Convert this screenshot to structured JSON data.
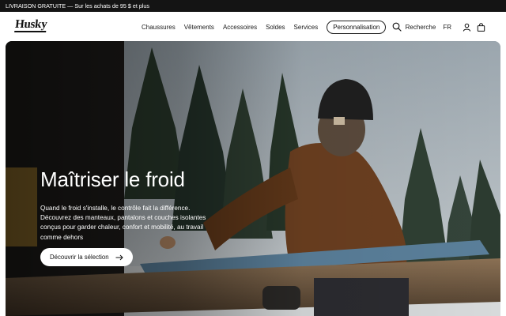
{
  "announcement": {
    "text": "LIVRAISON GRATUITE — Sur les achats de 95 $ et plus"
  },
  "header": {
    "logo": "Husky",
    "nav": [
      "Chaussures",
      "Vêtements",
      "Accessoires",
      "Soldes",
      "Services"
    ],
    "nav_pill": "Personnalisation",
    "search_label": "Recherche",
    "language": "FR",
    "icons": [
      "search-icon",
      "account-icon",
      "cart-icon"
    ]
  },
  "hero": {
    "title": "Maîtriser le froid",
    "body": "Quand le froid s'installe, le contrôle fait la différence. Découvrez des manteaux, pantalons et couches isolantes conçus pour garder chaleur, confort et mobilité, au travail comme dehors",
    "cta_label": "Découvrir la sélection",
    "cta_icon": "arrow-right-icon"
  },
  "colors": {
    "announcement_bg": "#141414",
    "hero_text": "#ffffff",
    "cta_bg": "#ffffff"
  }
}
